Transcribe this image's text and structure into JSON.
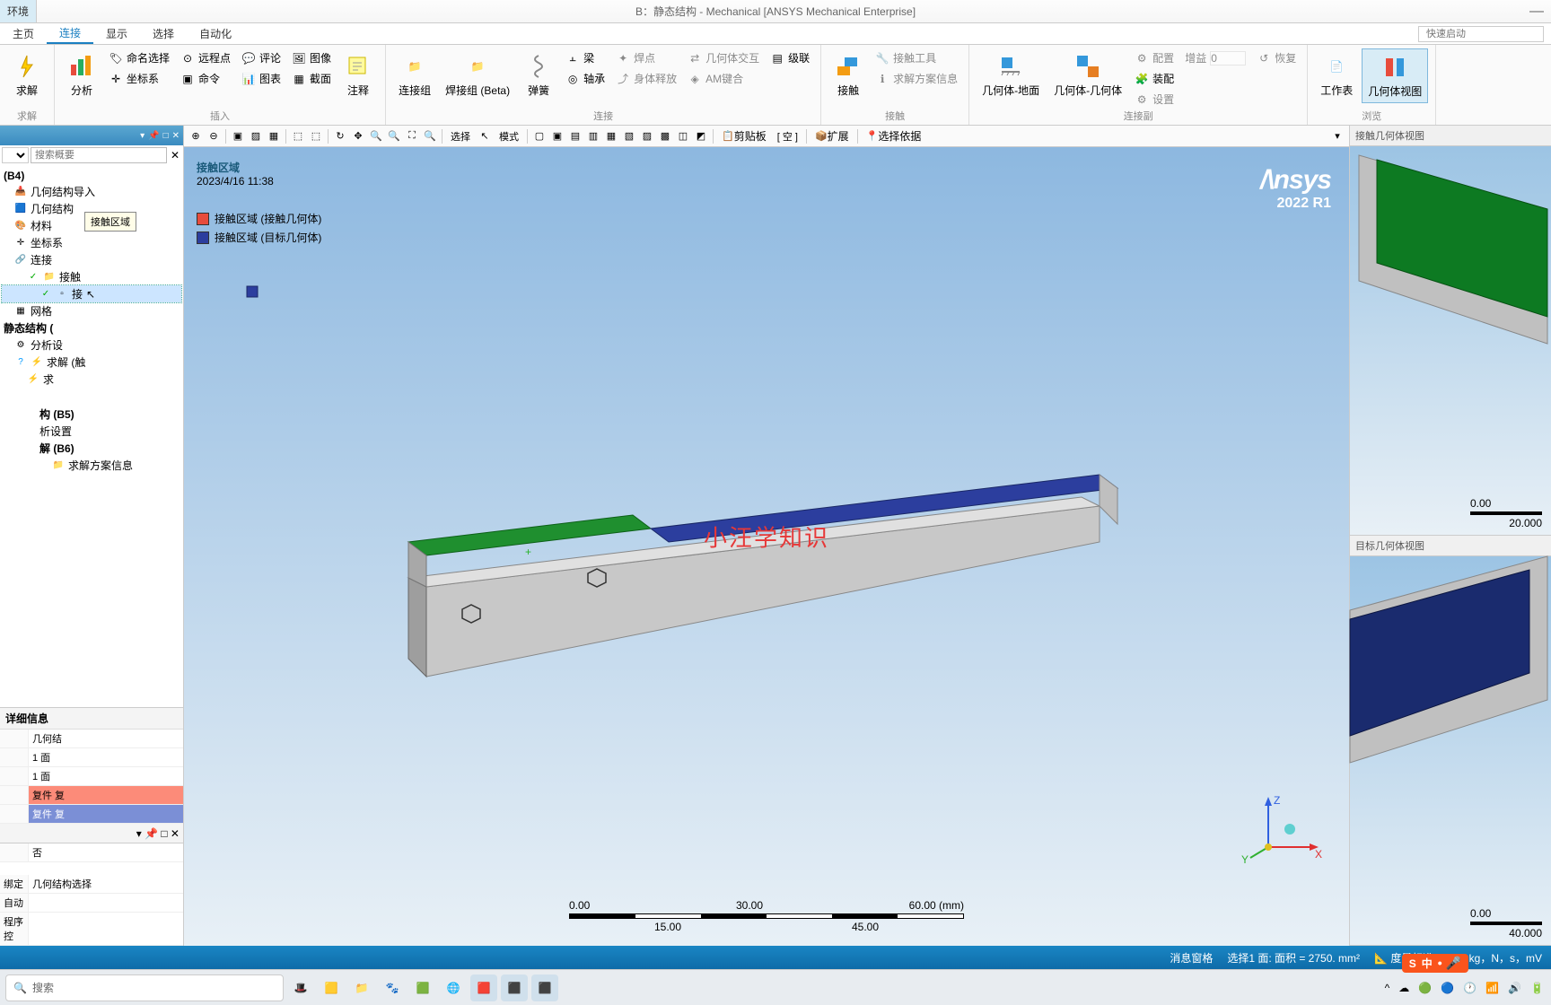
{
  "window": {
    "title": "B：静态结构 - Mechanical [ANSYS Mechanical Enterprise]",
    "env_label": "环境"
  },
  "tabs": {
    "main": "主页",
    "connect": "连接",
    "show": "显示",
    "select": "选择",
    "auto": "自动化",
    "quick": "快速启动"
  },
  "ribbon": {
    "solve": {
      "big": "求解",
      "label": "求解"
    },
    "insert": {
      "label": "插入",
      "analyze": "分析",
      "cs": "坐标系",
      "cmd": "命令",
      "chart": "图表",
      "section": "截面",
      "name_sel": "命名选择",
      "remote": "远程点",
      "comment": "评论",
      "image": "图像",
      "annotate": "注释"
    },
    "conn": {
      "label": "连接",
      "group": "连接组",
      "weld": "焊接组 (Beta)",
      "spring": "弹簧",
      "beam": "梁",
      "bearing": "轴承",
      "weldpt": "焊点",
      "body_int": "几何体交互",
      "grade": "级联",
      "body_rel": "身体释放",
      "am_bond": "AM键合"
    },
    "contact": {
      "label": "接触",
      "big": "接触",
      "tool": "接触工具",
      "sol_info": "求解方案信息"
    },
    "copy": {
      "label": "连接副",
      "ground": "几何体-地面",
      "body": "几何体-几何体",
      "config": "配置",
      "assemble": "装配",
      "gain": "增益",
      "restore": "恢复",
      "settings": "设置",
      "gain_val": "0"
    },
    "browse": {
      "label": "浏览",
      "worksheet": "工作表",
      "geo_view": "几何体视图"
    }
  },
  "toolbar": {
    "select": "选择",
    "mode": "模式",
    "clipboard": "剪贴板",
    "empty": "[ 空 ]",
    "expand": "扩展",
    "sel_basis": "选择依据"
  },
  "tree": {
    "search_ph": "搜索概要",
    "root": "(B4)",
    "geo_import": "几何结构导入",
    "geo": "几何结构",
    "material": "材料",
    "cs": "坐标系",
    "conn": "连接",
    "contact": "接触",
    "contact_item": "接",
    "mesh": "网格",
    "static": "静态结构 (",
    "analysis": "分析设",
    "solve": "求解 (触",
    "sol": "求",
    "contact_region": "接触区域",
    "struct5": "构 (B5)",
    "analysis2": "析设置",
    "sol6": "解 (B6)",
    "sol_info": "求解方案信息"
  },
  "details": {
    "header": "详细信息",
    "geo": "几何结",
    "face1": "1 面",
    "face2": "1 面",
    "comp1": "复件 复",
    "comp2": "复件 复",
    "no": "否",
    "bind": "绑定",
    "geo_sel": "几何结构选择",
    "auto": "自动",
    "seq": "程序控",
    "k_label": ""
  },
  "viewport": {
    "title": "接触区域",
    "timestamp": "2023/4/16 11:38",
    "legend1": "接触区域 (接触几何体)",
    "legend2": "接触区域 (目标几何体)",
    "logo1": "/\\nsys",
    "logo2": "2022 R1",
    "watermark": "小汪学知识",
    "scale": {
      "v0": "0.00",
      "v30": "30.00",
      "v60": "60.00 (mm)",
      "v15": "15.00",
      "v45": "45.00"
    },
    "axes": {
      "x": "X",
      "y": "Y",
      "z": "Z"
    }
  },
  "right": {
    "contact_view": "接触几何体视图",
    "target_view": "目标几何体视图",
    "s0": "0.00",
    "s20": "20.000",
    "s40": "40.000"
  },
  "status": {
    "msg": "消息窗格",
    "sel": "选择1 面: 面积 = 2750. mm²",
    "units": "度量标准 (mm，kg，N，s，mV"
  },
  "taskbar": {
    "search": "搜索",
    "ime": "中"
  },
  "tooltip": "接触区域"
}
